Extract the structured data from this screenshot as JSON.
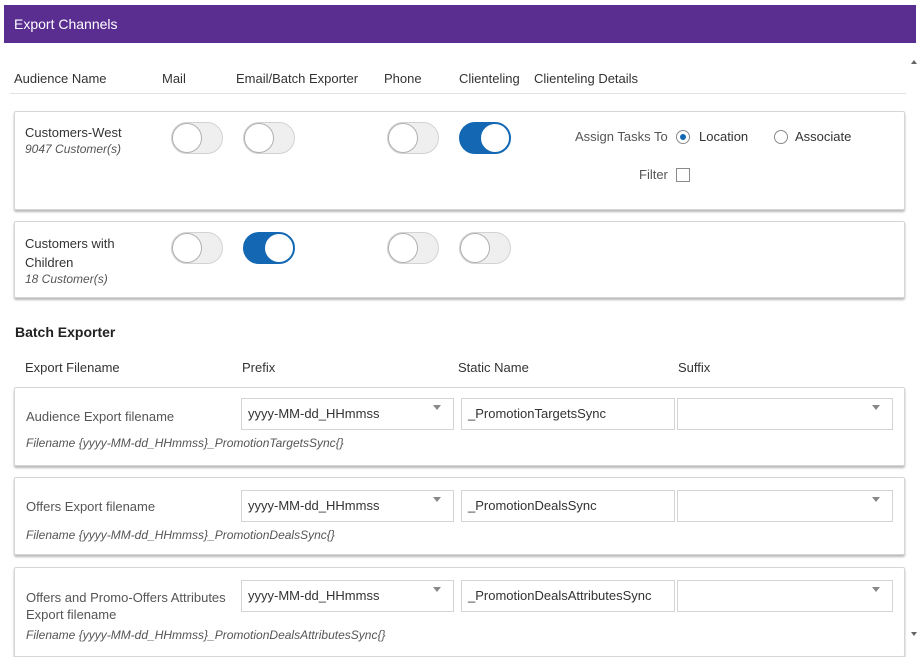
{
  "window": {
    "title": "Export Channels"
  },
  "columns": {
    "audience_name": "Audience Name",
    "mail": "Mail",
    "email_batch": "Email/Batch Exporter",
    "phone": "Phone",
    "clienteling": "Clienteling",
    "clienteling_details": "Clienteling Details"
  },
  "audiences": [
    {
      "name": "Customers-West",
      "count": "9047 Customer(s)",
      "mail": false,
      "email_batch": false,
      "phone": false,
      "clienteling": true,
      "details": {
        "assign_label": "Assign Tasks To",
        "options": [
          "Location",
          "Associate"
        ],
        "selected": "Location",
        "filter_label": "Filter",
        "filter_checked": false
      }
    },
    {
      "name": "Customers with Children",
      "count": "18 Customer(s)",
      "mail": false,
      "email_batch": true,
      "phone": false,
      "clienteling": false
    }
  ],
  "batch_exporter": {
    "title": "Batch Exporter",
    "headers": {
      "export_filename": "Export Filename",
      "prefix": "Prefix",
      "static_name": "Static Name",
      "suffix": "Suffix"
    },
    "rows": [
      {
        "label": "Audience Export filename",
        "prefix": "yyyy-MM-dd_HHmmss",
        "static_name": "_PromotionTargetsSync",
        "suffix": "",
        "filename_hint": "Filename {yyyy-MM-dd_HHmmss}_PromotionTargetsSync{}"
      },
      {
        "label": "Offers Export filename",
        "prefix": "yyyy-MM-dd_HHmmss",
        "static_name": "_PromotionDealsSync",
        "suffix": "",
        "filename_hint": "Filename {yyyy-MM-dd_HHmmss}_PromotionDealsSync{}"
      },
      {
        "label": "Offers and Promo-Offers Attributes Export filename",
        "prefix": "yyyy-MM-dd_HHmmss",
        "static_name": "_PromotionDealsAttributesSync",
        "suffix": "",
        "filename_hint": "Filename {yyyy-MM-dd_HHmmss}_PromotionDealsAttributesSync{}"
      }
    ]
  },
  "colors": {
    "title_bar": "#5a2d91",
    "toggle_on": "#1468b3",
    "radio_selected": "#1468b3"
  },
  "icons": {
    "dropdown": "chevron-down-icon",
    "scroll_up": "scroll-up-arrow-icon",
    "scroll_down": "scroll-down-arrow-icon"
  }
}
